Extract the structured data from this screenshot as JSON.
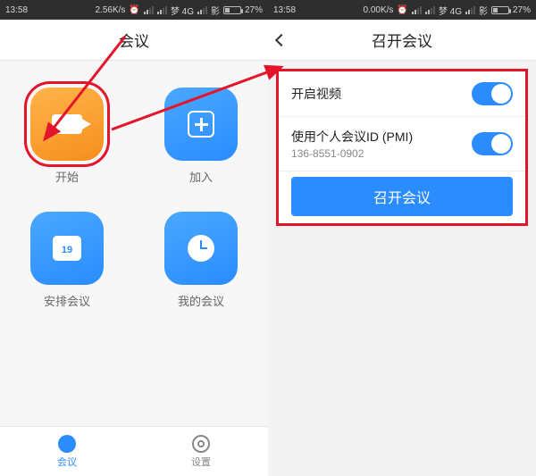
{
  "left": {
    "status": {
      "clock": "13:58",
      "net_speed": "2.56K/s",
      "carrier_text": "梦 4G",
      "signal_text": "影",
      "battery": "27%"
    },
    "header_title": "会议",
    "tiles": {
      "start": {
        "label": "开始"
      },
      "join": {
        "label": "加入"
      },
      "schedule": {
        "label": "安排会议",
        "calendar_day": "19"
      },
      "mine": {
        "label": "我的会议"
      }
    },
    "tabs": {
      "meeting": "会议",
      "settings": "设置"
    }
  },
  "right": {
    "status": {
      "clock": "13:58",
      "net_speed": "0.00K/s",
      "carrier_text": "梦 4G",
      "signal_text": "影",
      "battery": "27%"
    },
    "header_title": "召开会议",
    "options": {
      "enable_video_label": "开启视频",
      "use_pmi_label": "使用个人会议ID (PMI)",
      "pmi_value": "136-8551-0902"
    },
    "action_button": "召开会议"
  },
  "colors": {
    "accent_blue": "#2a8cff",
    "accent_orange": "#f68f1e",
    "annotation_red": "#e4142a"
  }
}
